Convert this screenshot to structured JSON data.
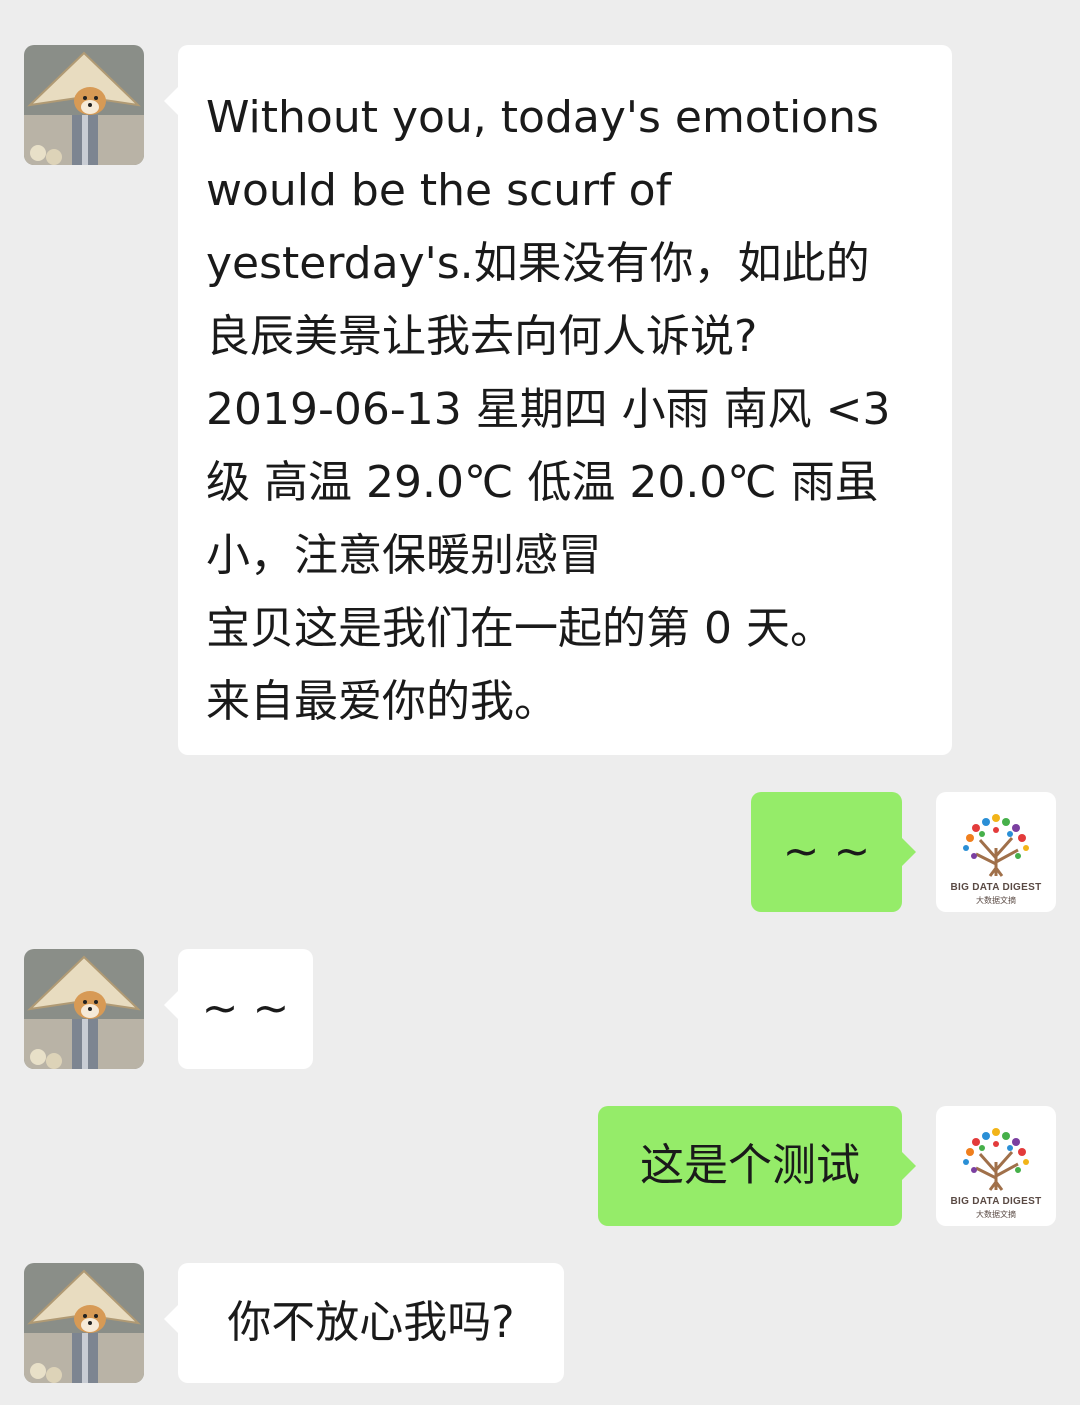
{
  "messages": [
    {
      "side": "in",
      "lines": [
        "Without you, today's emotions",
        "would be the scurf of",
        "yesterday's.如果没有你，如此的",
        "良辰美景让我去向何人诉说?",
        "2019-06-13 星期四 小雨 南风 <3",
        "级 高温 29.0℃ 低温 20.0℃ 雨虽",
        "小，注意保暖别感冒",
        "宝贝这是我们在一起的第 0 天。",
        "来自最爱你的我。"
      ]
    },
    {
      "side": "out",
      "text": "~ ~"
    },
    {
      "side": "in",
      "text": "~ ~"
    },
    {
      "side": "out",
      "text": "这是个测试"
    },
    {
      "side": "in",
      "text": "你不放心我吗?"
    }
  ],
  "me_avatar": {
    "logo_text": "BIG DATA DIGEST",
    "logo_subtext": "大数据文摘"
  },
  "colors": {
    "background": "#ededed",
    "incoming_bubble": "#ffffff",
    "outgoing_bubble": "#95ec69"
  }
}
